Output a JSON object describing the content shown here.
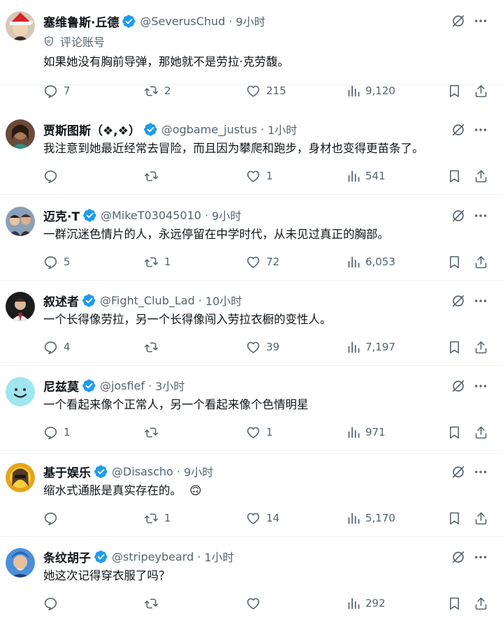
{
  "colors": {
    "verified": "#1d9bf0",
    "muted": "#536471",
    "text": "#0f1419",
    "divider": "#eff3f4"
  },
  "replies": [
    {
      "name": "塞维鲁斯·丘德",
      "handle": "@SeverusChud",
      "time": "9小时",
      "label": "评论账号",
      "text": "如果她没有胸前导弹，那她就不是劳拉·克劳馥。",
      "stats": {
        "replies": "7",
        "retweets": "2",
        "likes": "215",
        "views": "9,120"
      }
    },
    {
      "name": "贾斯图斯（❖,❖）",
      "handle": "@ogbame_justus",
      "time": "1小时",
      "text": "我注意到她最近经常去冒险，而且因为攀爬和跑步，身材也变得更苗条了。",
      "stats": {
        "replies": "",
        "retweets": "",
        "likes": "1",
        "views": "541"
      }
    },
    {
      "name": "迈克·T",
      "handle": "@MikeT03045010",
      "time": "9小时",
      "text": "一群沉迷色情片的人，永远停留在中学时代，从未见过真正的胸部。",
      "stats": {
        "replies": "5",
        "retweets": "1",
        "likes": "72",
        "views": "6,053"
      }
    },
    {
      "name": "叙述者",
      "handle": "@Fight_Club_Lad",
      "time": "10小时",
      "text": "一个长得像劳拉，另一个长得像闯入劳拉衣橱的变性人。",
      "stats": {
        "replies": "4",
        "retweets": "",
        "likes": "39",
        "views": "7,197"
      }
    },
    {
      "name": "尼兹莫",
      "handle": "@josfief",
      "time": "3小时",
      "text": "一个看起来像个正常人，另一个看起来像个色情明星",
      "stats": {
        "replies": "1",
        "retweets": "",
        "likes": "1",
        "views": "971"
      }
    },
    {
      "name": "基于娱乐",
      "handle": "@Disascho",
      "time": "9小时",
      "text": "缩水式通胀是真实存在的。",
      "emoji": "🙃",
      "stats": {
        "replies": "",
        "retweets": "1",
        "likes": "14",
        "views": "5,170"
      }
    },
    {
      "name": "条纹胡子",
      "handle": "@stripeybeard",
      "time": "1小时",
      "text": "她这次记得穿衣服了吗？",
      "stats": {
        "replies": "",
        "retweets": "",
        "likes": "",
        "views": "292"
      }
    }
  ]
}
